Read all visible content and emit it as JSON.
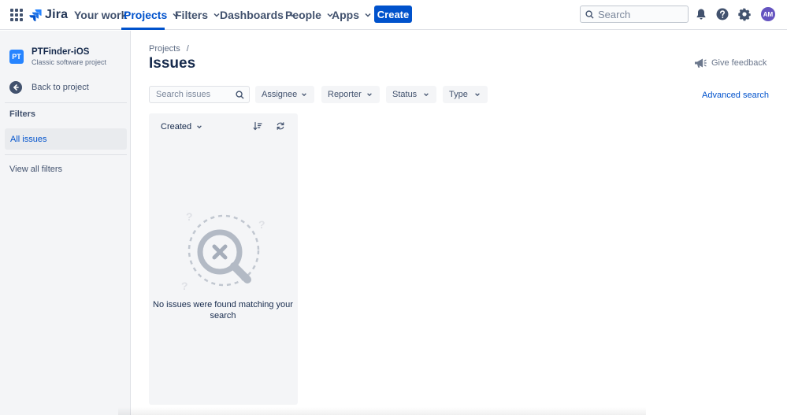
{
  "topnav": {
    "logo_text": "Jira",
    "items": [
      {
        "label": "Your work"
      },
      {
        "label": "Projects"
      },
      {
        "label": "Filters"
      },
      {
        "label": "Dashboards"
      },
      {
        "label": "People"
      },
      {
        "label": "Apps"
      }
    ],
    "create_label": "Create",
    "search_placeholder": "Search",
    "avatar_initials": "AM",
    "accent_color": "#0052cc"
  },
  "sidebar": {
    "project_avatar": "PT",
    "project_name": "PTFinder-iOS",
    "project_type": "Classic software project",
    "back_label": "Back to project",
    "filters_heading": "Filters",
    "all_issues_label": "All issues",
    "view_all_filters_label": "View all filters"
  },
  "main": {
    "breadcrumb": [
      "Projects",
      "/"
    ],
    "title": "Issues",
    "feedback_label": "Give feedback",
    "search_placeholder": "Search issues",
    "filters": [
      {
        "label": "Assignee"
      },
      {
        "label": "Reporter"
      },
      {
        "label": "Status"
      },
      {
        "label": "Type"
      }
    ],
    "advanced_search_label": "Advanced search",
    "sort_label": "Created",
    "empty_message": "No issues were found matching your search"
  },
  "icons": [
    "app-switcher-icon",
    "jira-logo-icon",
    "chevron-down-icon",
    "search-icon",
    "notification-bell-icon",
    "help-icon",
    "settings-icon",
    "back-arrow-icon",
    "megaphone-icon",
    "sort-order-icon",
    "refresh-icon",
    "no-results-illustration"
  ]
}
